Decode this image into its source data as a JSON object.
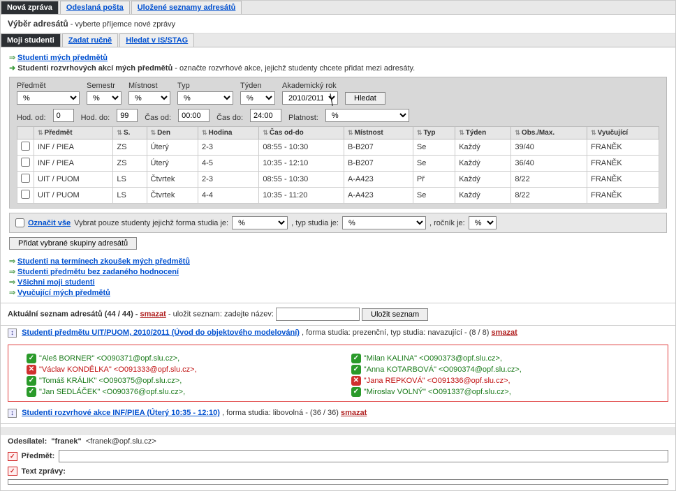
{
  "top_tabs": [
    "Nová zpráva",
    "Odeslaná pošta",
    "Uložené seznamy adresátů"
  ],
  "header": {
    "title": "Výběr adresátů",
    "sub": " - vyberte příjemce nové zprávy"
  },
  "sub_tabs": [
    "Moji studenti",
    "Zadat ručně",
    "Hledat v IS/STAG"
  ],
  "links": {
    "my_subjects": "Studenti mých předmětů",
    "schedule_actions": "Studenti rozvrhových akcí mých předmětů",
    "schedule_actions_suffix": " - označte rozvrhové akce, jejichž studenty chcete přidat mezi adresáty.",
    "exam_terms": "Studenti na termínech zkoušek mých předmětů",
    "no_grade": "Studenti předmětu bez zadaného hodnocení",
    "all_students": "Všichni moji studenti",
    "teachers": "Vyučující mých předmětů"
  },
  "filter": {
    "labels": {
      "subject": "Předmět",
      "semester": "Semestr",
      "room": "Místnost",
      "type": "Typ",
      "week": "Týden",
      "year": "Akademický rok"
    },
    "values": {
      "subject": "%",
      "semester": "%",
      "room": "%",
      "type": "%",
      "week": "%",
      "year": "2010/2011"
    },
    "search_btn": "Hledat",
    "row2": {
      "hod_od_l": "Hod. od:",
      "hod_od_v": "0",
      "hod_do_l": "Hod. do:",
      "hod_do_v": "99",
      "cas_od_l": "Čas od:",
      "cas_od_v": "00:00",
      "cas_do_l": "Čas do:",
      "cas_do_v": "24:00",
      "platnost_l": "Platnost:",
      "platnost_v": "%"
    }
  },
  "table": {
    "headers": [
      "Předmět",
      "S.",
      "Den",
      "Hodina",
      "Čas od-do",
      "Místnost",
      "Typ",
      "Týden",
      "Obs./Max.",
      "Vyučující"
    ],
    "rows": [
      [
        "INF / PIEA",
        "ZS",
        "Úterý",
        "2-3",
        "08:55 - 10:30",
        "B-B207",
        "Se",
        "Každý",
        "39/40",
        "FRANĚK"
      ],
      [
        "INF / PIEA",
        "ZS",
        "Úterý",
        "4-5",
        "10:35 - 12:10",
        "B-B207",
        "Se",
        "Každý",
        "36/40",
        "FRANĚK"
      ],
      [
        "UIT / PUOM",
        "LS",
        "Čtvrtek",
        "2-3",
        "08:55 - 10:30",
        "A-A423",
        "Př",
        "Každý",
        "8/22",
        "FRANĚK"
      ],
      [
        "UIT / PUOM",
        "LS",
        "Čtvrtek",
        "4-4",
        "10:35 - 11:20",
        "A-A423",
        "Se",
        "Každý",
        "8/22",
        "FRANĚK"
      ]
    ]
  },
  "mark": {
    "check_all": "Označit vše",
    "filter_text1": "Vybrat pouze studenty jejichž forma studia je:",
    "filter_text2": ", typ studia je:",
    "filter_text3": ", ročník je:",
    "sel_v": "%",
    "add_btn": "Přidat vybrané skupiny adresátů"
  },
  "current_list": {
    "title": "Aktuální seznam adresátů (44 / 44) -",
    "del": "smazat",
    "save_text": " - uložit seznam: zadejte název:",
    "save_btn": "Uložit seznam"
  },
  "group1": {
    "title": "Studenti předmětu UIT/PUOM, 2010/2011 (Úvod do objektového modelování)",
    "suffix": ",  forma studia: prezenční, typ studia: navazující - (8 / 8)",
    "del": "smazat",
    "emails": [
      {
        "ok": true,
        "name": "\"Aleš BORNER\"",
        "addr": "<O090371@opf.slu.cz>"
      },
      {
        "ok": true,
        "name": "\"Milan KALINA\"",
        "addr": "<O090373@opf.slu.cz>"
      },
      {
        "ok": false,
        "name": "\"Václav KONDĚLKA\"",
        "addr": "<O091333@opf.slu.cz>"
      },
      {
        "ok": true,
        "name": "\"Anna KOTARBOVÁ\"",
        "addr": "<O090374@opf.slu.cz>"
      },
      {
        "ok": true,
        "name": "\"Tomáš KRÁLIK\"",
        "addr": "<O090375@opf.slu.cz>"
      },
      {
        "ok": false,
        "name": "\"Jana REPKOVÁ\"",
        "addr": "<O091336@opf.slu.cz>"
      },
      {
        "ok": true,
        "name": "\"Jan SEDLÁČEK\"",
        "addr": "<O090376@opf.slu.cz>"
      },
      {
        "ok": true,
        "name": "\"Miroslav VOLNÝ\"",
        "addr": "<O091337@opf.slu.cz>"
      }
    ]
  },
  "group2": {
    "title": "Studenti rozvrhové akce INF/PIEA (Úterý 10:35 - 12:10)",
    "suffix": ",  forma studia: libovolná - (36 / 36)",
    "del": "smazat"
  },
  "sender": {
    "label": "Odesílatel:",
    "name": "\"franek\"",
    "addr": "<franek@opf.slu.cz>",
    "subject_label": "Předmět:",
    "text_label": "Text zprávy:"
  }
}
